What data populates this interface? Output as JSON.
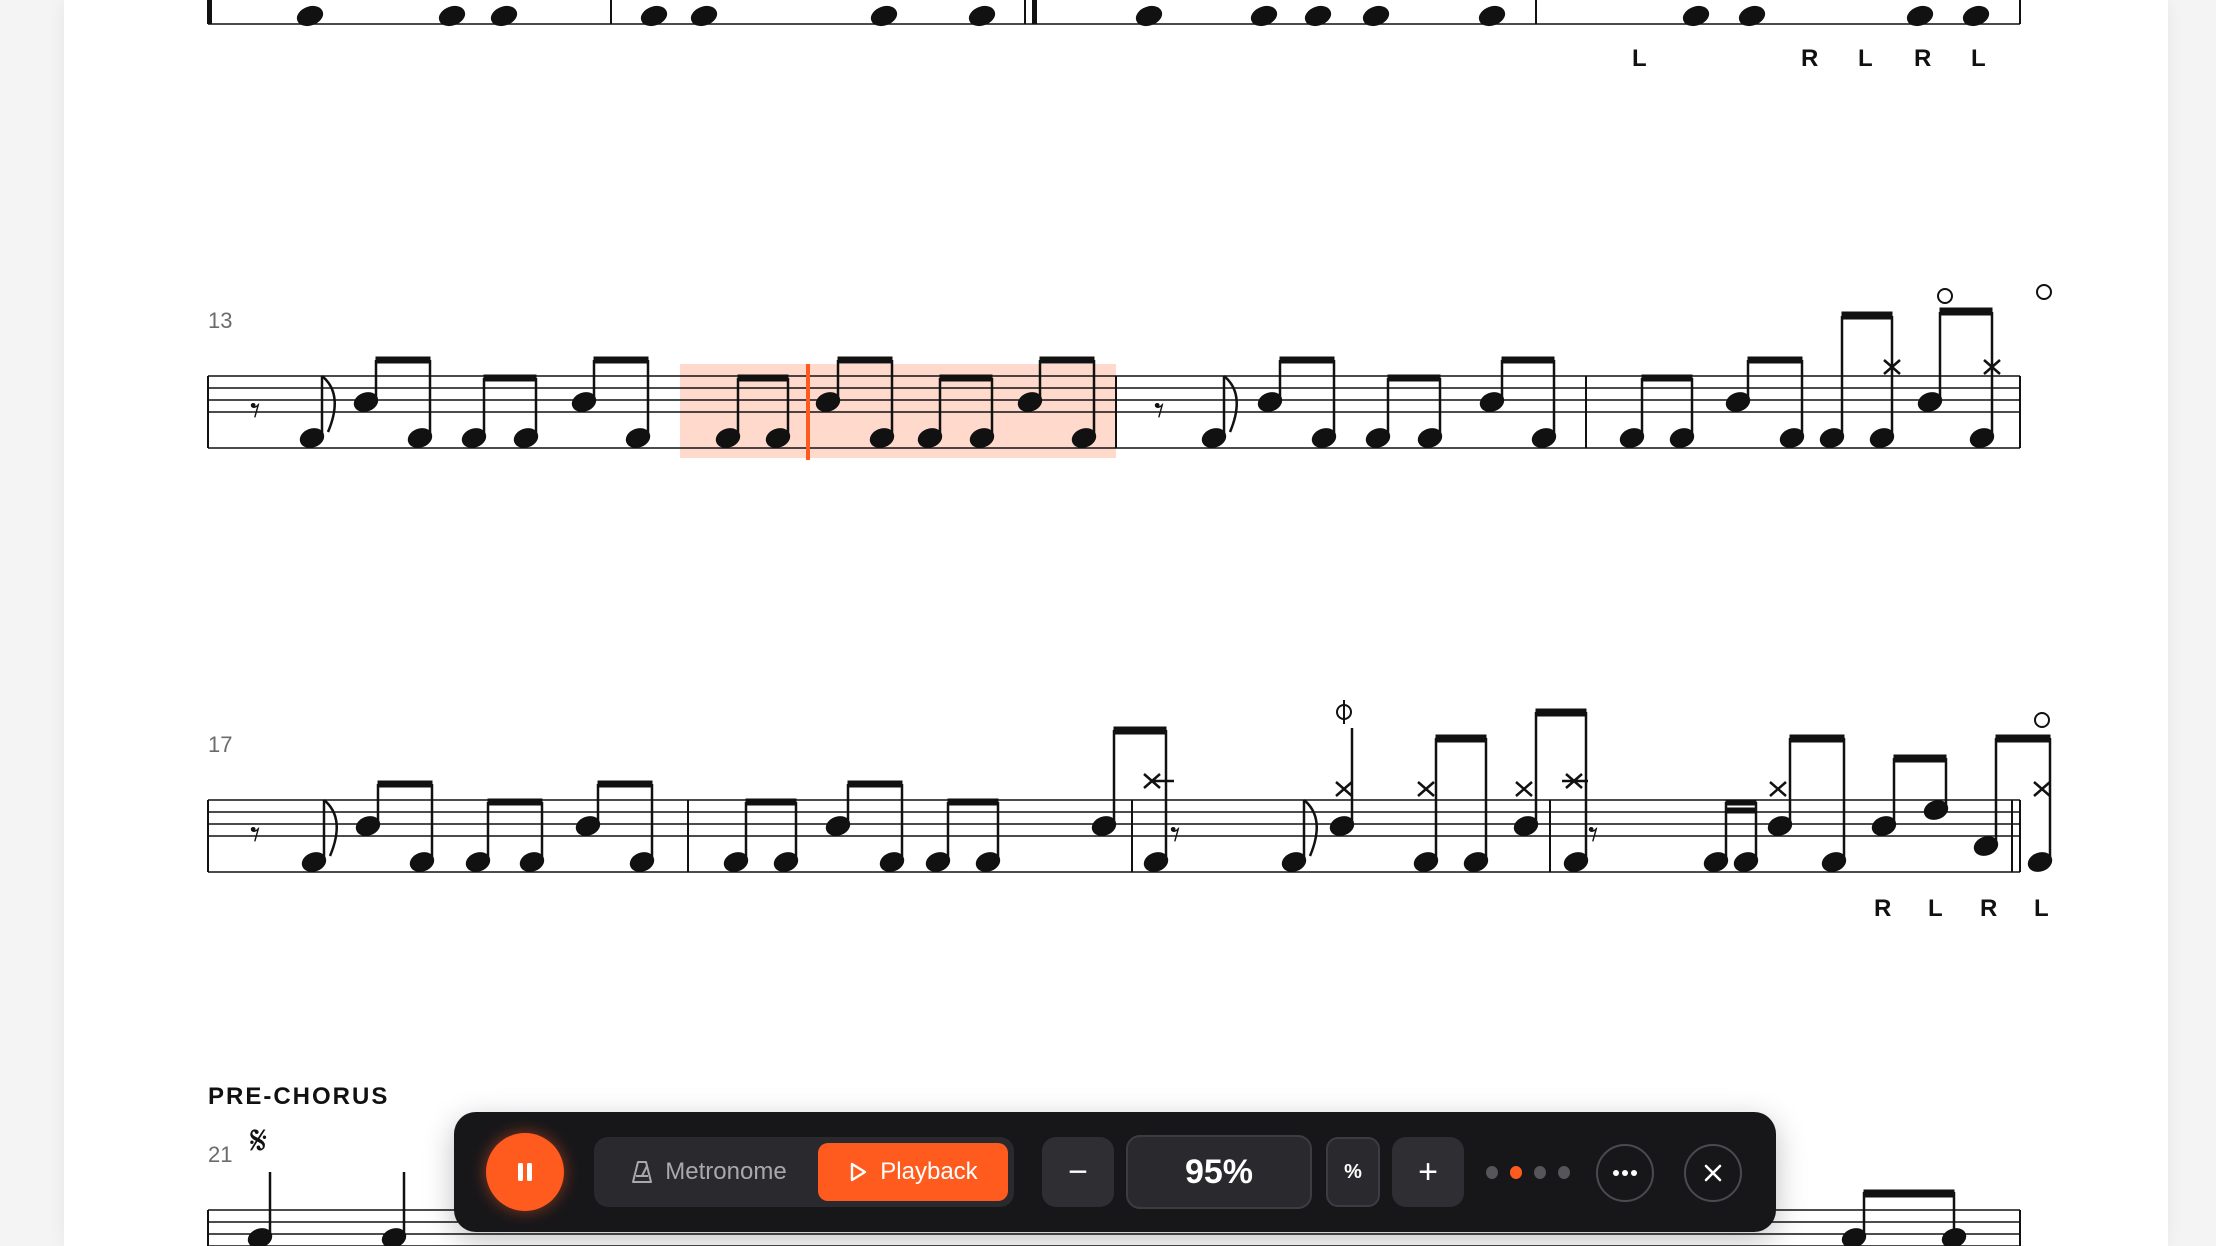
{
  "sections": {
    "prechorus_label": "PRE-CHORUS"
  },
  "measure_numbers": {
    "m13": "13",
    "m17": "17",
    "m21": "21"
  },
  "sticking": {
    "row1": [
      "L",
      "R",
      "L",
      "R",
      "L"
    ],
    "row3": [
      "R",
      "L",
      "R",
      "L"
    ]
  },
  "toolbar": {
    "metronome_label": "Metronome",
    "playback_label": "Playback",
    "minus_label": "−",
    "zoom_value": "95%",
    "percent_label": "%",
    "plus_label": "+",
    "page_count": 4,
    "active_page": 2
  },
  "colors": {
    "accent": "#ff5b1f",
    "highlight": "#ffd9cc",
    "toolbar_bg": "#17171a"
  },
  "icons": {
    "play_pause": "pause-icon",
    "metronome": "metronome-icon",
    "playback": "play-icon",
    "more": "more-icon",
    "close": "close-icon",
    "segno": "segno-icon"
  }
}
